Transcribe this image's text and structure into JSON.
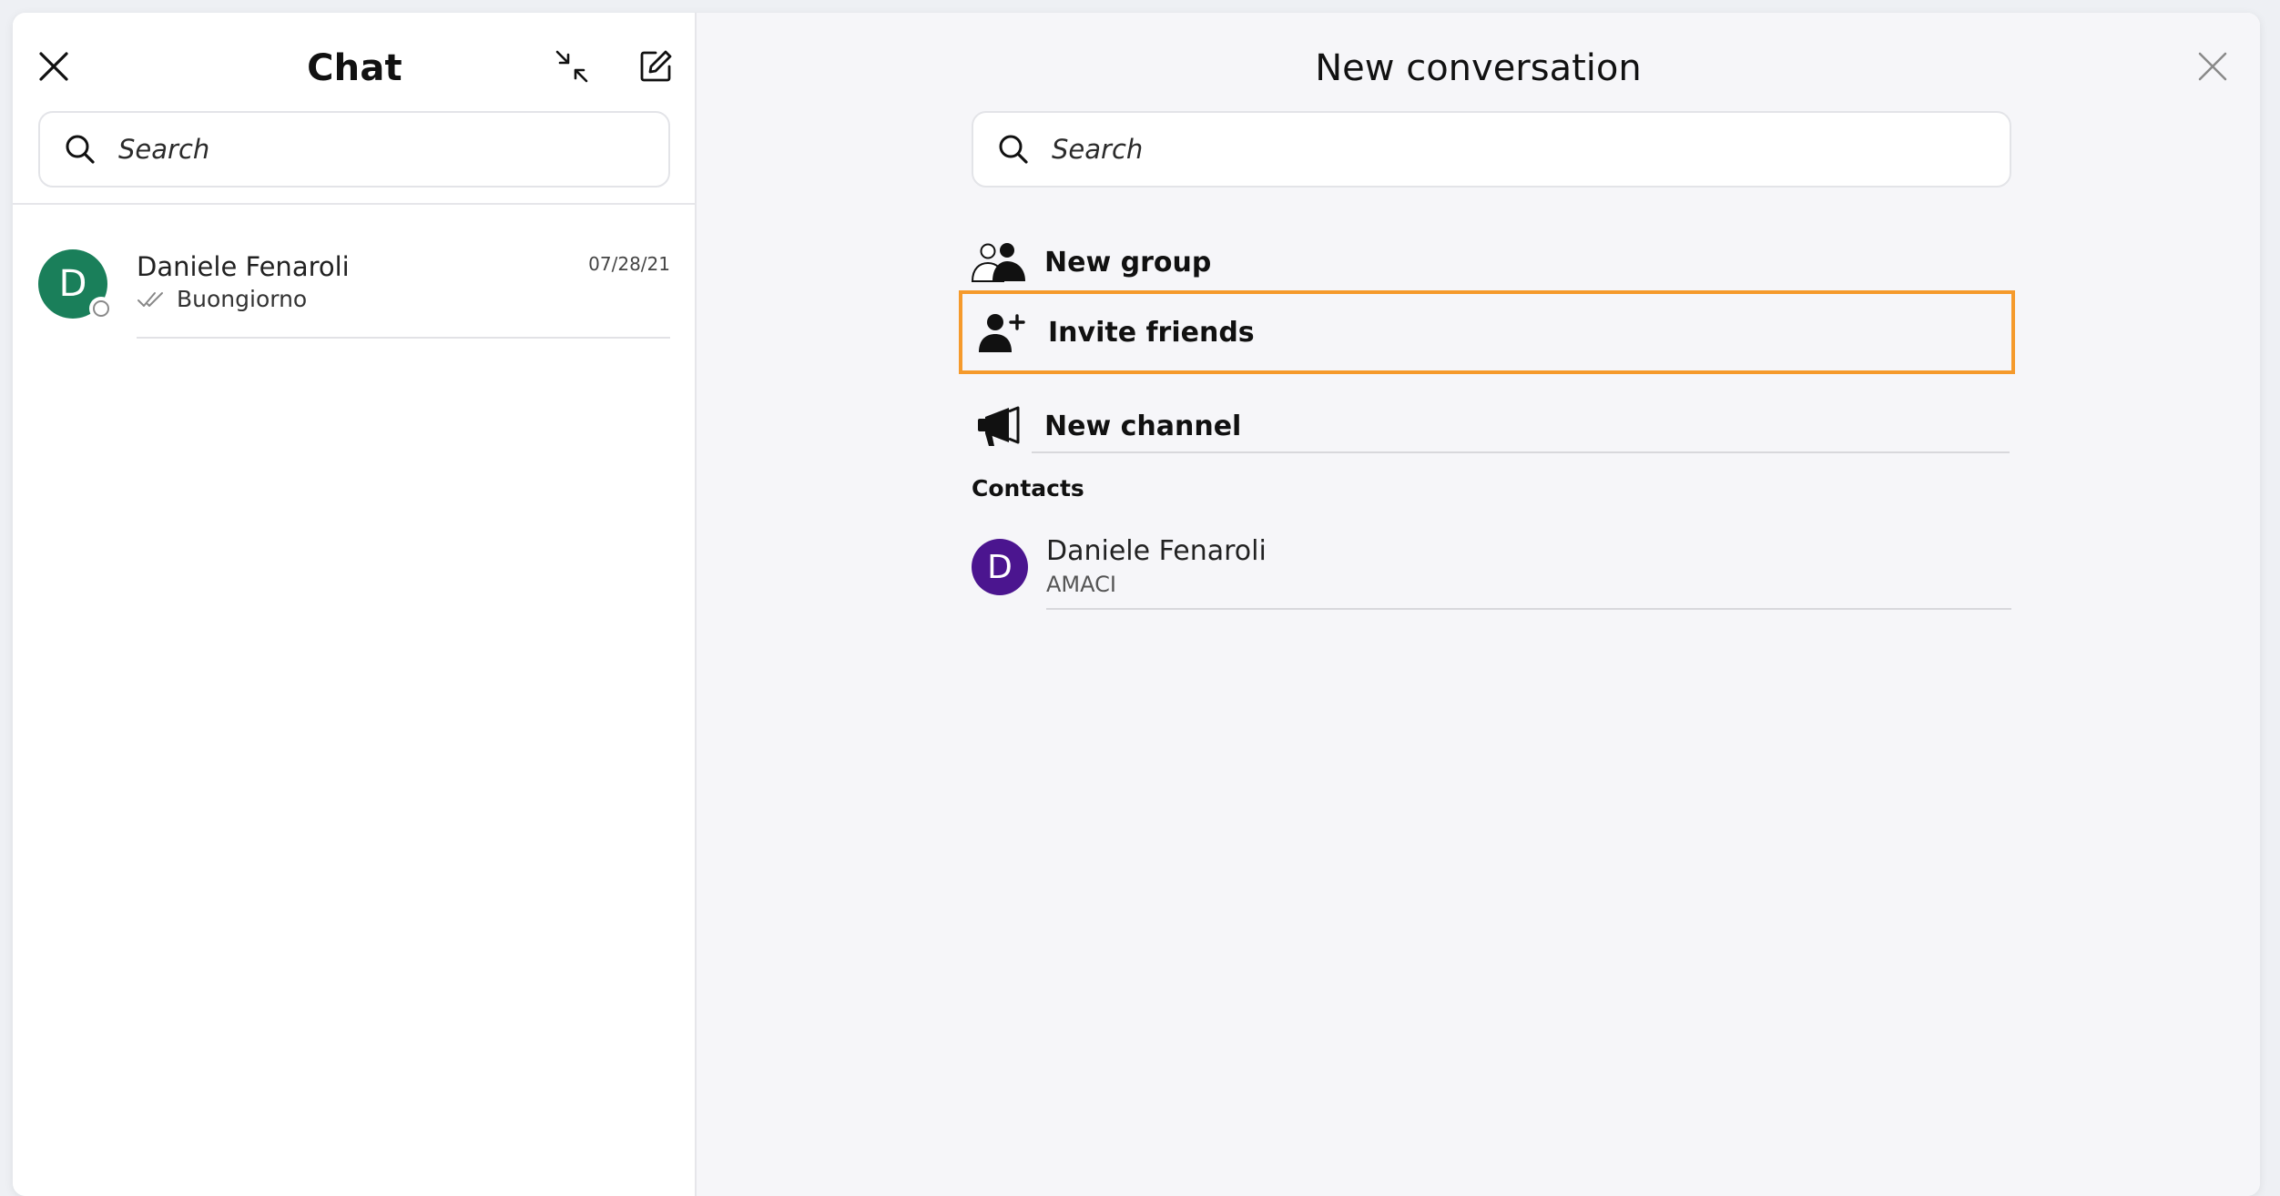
{
  "left_panel": {
    "title": "Chat",
    "search": {
      "placeholder": "Search"
    },
    "conversations": [
      {
        "avatar_letter": "D",
        "avatar_color": "#1a7f5a",
        "name": "Daniele Fenaroli",
        "date": "07/28/21",
        "preview": "Buongiorno",
        "status_icon": "double-check-icon"
      }
    ]
  },
  "right_panel": {
    "title": "New conversation",
    "search": {
      "placeholder": "Search"
    },
    "actions": [
      {
        "label": "New group",
        "icon": "group-icon"
      },
      {
        "label": "Invite friends",
        "icon": "add-person-icon",
        "highlighted": true,
        "highlight_color": "#f59a2c"
      },
      {
        "label": "New channel",
        "icon": "megaphone-icon"
      }
    ],
    "contacts_label": "Contacts",
    "contacts": [
      {
        "avatar_letter": "D",
        "avatar_color": "#4b158f",
        "name": "Daniele Fenaroli",
        "subtitle": "AMACI"
      }
    ]
  }
}
